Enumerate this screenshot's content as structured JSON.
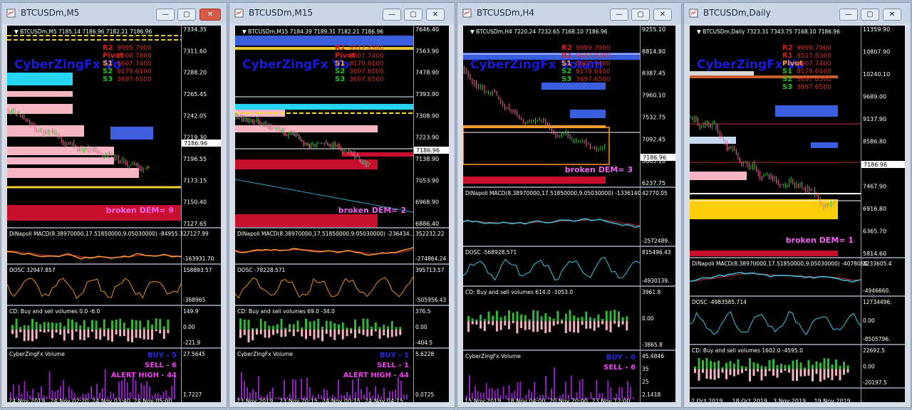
{
  "colors": {
    "buy_bar": "#2fb83a",
    "sell_bar": "#f2b3c0",
    "macd_main": "#ff9a2e",
    "macd_signal": "#c2303c",
    "osc": "#e8902a",
    "osc_blue": "#3fc4e0",
    "price_up": "#22c022",
    "price_down": "#f06aa0",
    "watermark": "#1a1ae0"
  },
  "windows": [
    {
      "title": "BTCUSDm,M5",
      "active": true,
      "info": "BTCUSDm,M5  7185.14 7186.96 7182.21 7186.96",
      "watermark": "CyberZingFx Vo",
      "pivots": [
        "R2",
        "Pivot",
        "S1",
        "S2",
        "S3"
      ],
      "pivot_nums": [
        "9999.7900",
        "2608.7800",
        "8607.7400",
        "8179.6100",
        "3697.6500"
      ],
      "price_axis": [
        "7334.35",
        "7311.60",
        "7288.20",
        "7265.45",
        "7242.05",
        "7219.30",
        "7196.55",
        "7173.15",
        "7150.40",
        "7127.65"
      ],
      "current_price": "7186.96",
      "broken": "broken DEM= 9",
      "macd_label": "DiNapoli MACD(8.38970000,17.51850000,9.05030000) -84955.3...",
      "macd_axis": [
        "27127.99",
        "-163931.70"
      ],
      "dosc_label": "DOSC 32947.857",
      "dosc_axis": [
        "158893.57",
        "-368965"
      ],
      "cd_label": "CD: Buy and sell volumes  0.0 -6.0",
      "cd_axis": [
        "149.9",
        "0.00",
        "-221.9"
      ],
      "vol_label": "CyberZingFx Volume",
      "vol_lines": [
        "BUY -  5",
        "SELL -  6",
        "ALERT HIGH - 44"
      ],
      "vol_axis": [
        "27.5645",
        "1.7227"
      ],
      "time_axis": [
        "24 Nov 2019",
        "24 Nov 02:20",
        "24 Nov 03:40",
        "24 Nov 05:00"
      ]
    },
    {
      "title": "BTCUSDm,M15",
      "active": false,
      "info": "BTCUSDm,M15  7184.39 7189.31 7182.21 7186.96",
      "watermark": "CyberZingFx Vo",
      "pivots": [
        "R1",
        "Pivot",
        "S1",
        "S2",
        "S3"
      ],
      "pivot_nums": [
        "9517.8300",
        "8607.7400",
        "8179.6100",
        "3697.6500",
        "3697.6500"
      ],
      "price_axis": [
        "7646.40",
        "7563.90",
        "7478.90",
        "7393.90",
        "7308.90",
        "7223.90",
        "7138.90",
        "7053.90",
        "6968.90",
        "6886.40"
      ],
      "current_price": "7186.96",
      "broken": "broken DEM= 2",
      "macd_label": "DiNapoli MACD(8.38970000,17.51850000,9.05030000) -236434...",
      "macd_axis": [
        "352232.22",
        "-274864.24"
      ],
      "dosc_label": "DOSC -78228.571",
      "dosc_axis": [
        "395713.57",
        "-505956.43"
      ],
      "cd_label": "CD: Buy and sell volumes  69.0 -34.0",
      "cd_axis": [
        "376.5",
        "0.00",
        "-404.5"
      ],
      "vol_label": "CyberZingFx Volume",
      "vol_lines": [
        "BUY -  1",
        "SELL -  1",
        "ALERT HIGH - 44"
      ],
      "vol_axis": [
        "5.6228",
        "0.0725"
      ],
      "time_axis": [
        "23 Nov 2019",
        "23 Nov 20:15",
        "24 Nov 00:15",
        "24 Nov 04:15"
      ]
    },
    {
      "title": "BTCUSDm,H4",
      "active": false,
      "info": "BTCUSDm,H4  7220.24 7232.65 7168.10 7186.96",
      "watermark": "CyberZingFx Volum",
      "pivots": [
        "R2",
        "R1",
        "S1",
        "S2",
        "S3"
      ],
      "pivot_nums": [
        "9999.7900",
        "9517.8300",
        "8607.7400",
        "8179.6100",
        "3697.6500"
      ],
      "price_axis": [
        "9255.10",
        "8814.80",
        "8387.45",
        "7960.10",
        "7532.75",
        "7092.45",
        "6665.10",
        "6237.75"
      ],
      "current_price": "7186.96",
      "broken": "broken DEM= 3",
      "macd_label": "DiNapoli MACD(8.38970000,17.51850000,9.05030000) -1336140",
      "macd_axis": [
        "42770.05",
        "-2572489."
      ],
      "dosc_label": "DOSC -568928.571",
      "dosc_axis": [
        "815496.43",
        "-4930139."
      ],
      "cd_label": "CD: Buy and sell volumes  614.0 -1053.0",
      "cd_axis": [
        "3961.8",
        "0.00",
        "-3865.8"
      ],
      "vol_label": "CyberZingFx Volume",
      "vol_lines": [
        "BUY -  0",
        "SELL -  6"
      ],
      "vol_axis": [
        "45.4846",
        "35",
        "25",
        "2.1418"
      ],
      "time_axis": [
        "15 Nov 2019",
        "18 Nov 04:00",
        "20 Nov 20:00",
        "23 Nov 12:00"
      ]
    },
    {
      "title": "BTCUSDm,Daily",
      "active": false,
      "info": "BTCUSDm,Daily  7323.31 7343.75 7168.10 7186.96",
      "watermark": "CyberZingFx Vo",
      "pivots": [
        "R2",
        "R1",
        "Pivot",
        "S1",
        "S2",
        "S3"
      ],
      "pivot_nums": [
        "9999.7900",
        "9517.8300",
        "8607.7400",
        "8179.6100",
        "3697.6500",
        "3697.6500"
      ],
      "price_axis": [
        "11359.90",
        "10807.90",
        "10240.10",
        "9689.00",
        "9137.90",
        "8586.80",
        "8019.00",
        "7467.90",
        "6916.80",
        "6365.70",
        "5814.60"
      ],
      "current_price": "7186.96",
      "broken": "broken DEM= 1",
      "macd_label": "DiNapoli MACD(8.38970000,17.51850000,9.05030000) -4078060",
      "macd_axis": [
        "3233605.4",
        "-4946660."
      ],
      "dosc_label": "DOSC -4983585.714",
      "dosc_axis": [
        "12734496.",
        "0.00",
        "-8505796."
      ],
      "cd_label": "CD: Buy and sell volumes  1602.0 -4595.0",
      "cd_axis": [
        "22692.5",
        "0.00",
        "-20197.5"
      ],
      "vol_label": "",
      "vol_lines": [],
      "vol_axis": [],
      "time_axis": [
        "2 Oct 2019",
        "18 Oct 2019",
        "3 Nov 2019",
        "19 Nov 2019"
      ]
    }
  ],
  "buttons": {
    "min": "—",
    "max": "▢",
    "close": "✕"
  }
}
